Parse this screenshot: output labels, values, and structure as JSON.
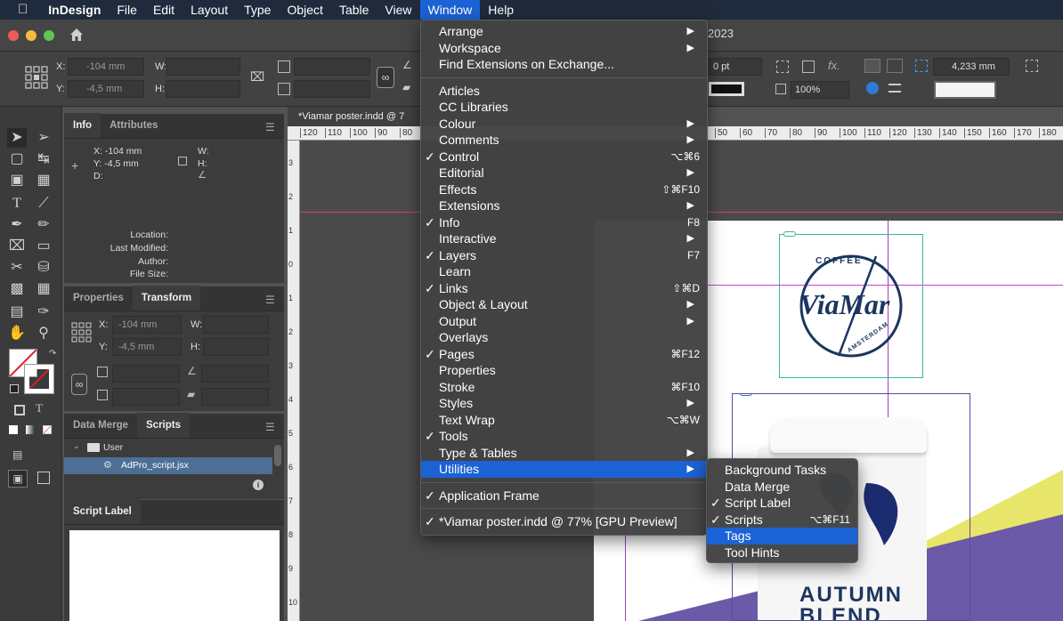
{
  "menubar": {
    "apple": "",
    "app_name": "InDesign",
    "items": [
      "File",
      "Edit",
      "Layout",
      "Type",
      "Object",
      "Table",
      "View",
      "Window",
      "Help"
    ]
  },
  "appbar": {
    "title_fragment": "2023"
  },
  "control": {
    "x_label": "X:",
    "x_value": "-104 mm",
    "y_label": "Y:",
    "y_value": "-4,5 mm",
    "w_label": "W:",
    "h_label": "H:",
    "stroke_weight": "0 pt",
    "opacity": "100%",
    "gutter": "4,233 mm",
    "fx": "fx."
  },
  "info_panel": {
    "tabs": [
      "Info",
      "Attributes"
    ],
    "x": "X: -104 mm",
    "y": "Y: -4,5 mm",
    "d": "D:",
    "w": "W:",
    "h": "H:",
    "location": "Location:",
    "last_modified": "Last Modified:",
    "author": "Author:",
    "file_size": "File Size:"
  },
  "transform_panel": {
    "tabs": [
      "Properties",
      "Transform"
    ],
    "x_label": "X:",
    "x_value": "-104 mm",
    "y_label": "Y:",
    "y_value": "-4,5 mm",
    "w_label": "W:",
    "h_label": "H:"
  },
  "scripts_panel": {
    "tabs": [
      "Data Merge",
      "Scripts"
    ],
    "folder": "User",
    "script": "AdPro_script.jsx"
  },
  "script_label_panel": {
    "tab": "Script Label"
  },
  "document": {
    "tab": "*Viamar poster.indd @ 7",
    "ruler_ticks_left": [
      "120",
      "110",
      "100",
      "90",
      "80"
    ],
    "ruler_ticks_right": [
      "50",
      "60",
      "70",
      "80",
      "90",
      "100",
      "110",
      "120",
      "130",
      "140",
      "150",
      "160",
      "170",
      "180"
    ],
    "vertical_ticks": [
      "3",
      "2",
      "1",
      "0",
      "1",
      "2",
      "3",
      "4",
      "5",
      "6",
      "7",
      "8",
      "9",
      "10"
    ],
    "logo_top": "COFFEE",
    "logo_main": "ViaMar",
    "logo_bottom": "AMSTERDAM",
    "cup_line1": "AUTUMN",
    "cup_line2": "BLEND"
  },
  "window_menu": {
    "group1": [
      {
        "label": "Arrange",
        "sub": true
      },
      {
        "label": "Workspace",
        "sub": true
      },
      {
        "label": "Find Extensions on Exchange..."
      }
    ],
    "group2": [
      {
        "label": "Articles"
      },
      {
        "label": "CC Libraries"
      },
      {
        "label": "Colour",
        "sub": true
      },
      {
        "label": "Comments",
        "sub": true
      },
      {
        "label": "Control",
        "check": true,
        "shortcut": "⌥⌘6"
      },
      {
        "label": "Editorial",
        "sub": true
      },
      {
        "label": "Effects",
        "shortcut": "⇧⌘F10"
      },
      {
        "label": "Extensions",
        "sub": true
      },
      {
        "label": "Info",
        "check": true,
        "shortcut": "F8"
      },
      {
        "label": "Interactive",
        "sub": true
      },
      {
        "label": "Layers",
        "check": true,
        "shortcut": "F7"
      },
      {
        "label": "Learn"
      },
      {
        "label": "Links",
        "check": true,
        "shortcut": "⇧⌘D"
      },
      {
        "label": "Object & Layout",
        "sub": true
      },
      {
        "label": "Output",
        "sub": true
      },
      {
        "label": "Overlays"
      },
      {
        "label": "Pages",
        "check": true,
        "shortcut": "⌘F12"
      },
      {
        "label": "Properties"
      },
      {
        "label": "Stroke",
        "shortcut": "⌘F10"
      },
      {
        "label": "Styles",
        "sub": true
      },
      {
        "label": "Text Wrap",
        "shortcut": "⌥⌘W"
      },
      {
        "label": "Tools",
        "check": true
      },
      {
        "label": "Type & Tables",
        "sub": true
      },
      {
        "label": "Utilities",
        "sub": true,
        "highlight": true
      }
    ],
    "group3": [
      {
        "label": "Application Frame",
        "check": true
      }
    ],
    "group4": [
      {
        "label": "*Viamar poster.indd @ 77% [GPU Preview]",
        "check": true
      }
    ]
  },
  "utilities_menu": [
    {
      "label": "Background Tasks"
    },
    {
      "label": "Data Merge"
    },
    {
      "label": "Script Label",
      "check": true
    },
    {
      "label": "Scripts",
      "check": true,
      "shortcut": "⌥⌘F11"
    },
    {
      "label": "Tags",
      "highlight": true
    },
    {
      "label": "Tool Hints"
    }
  ],
  "colors": {
    "menubar": "#1f2a3c",
    "highlight": "#1b62d5",
    "logo": "#1c3660",
    "purple": "#6a5aa8",
    "yellow": "#e8e66a"
  }
}
